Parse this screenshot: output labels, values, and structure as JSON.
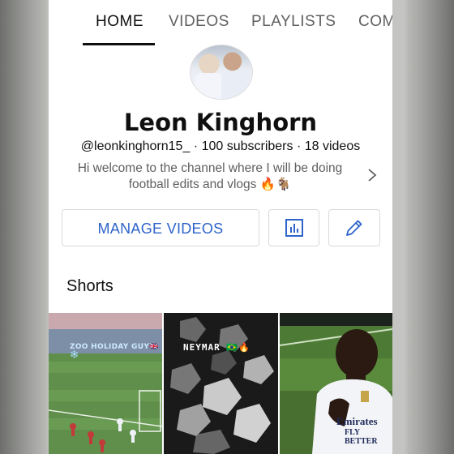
{
  "tabs": [
    {
      "label": "HOME",
      "active": true
    },
    {
      "label": "VIDEOS",
      "active": false
    },
    {
      "label": "PLAYLISTS",
      "active": false
    },
    {
      "label": "COM",
      "active": false
    }
  ],
  "channel": {
    "name": "Leon Kinghorn",
    "meta": "@leonkinghorn15_ · 100 subscribers · 18 videos",
    "description_line1": "Hi welcome to the channel where I will be doing",
    "description_line2": "football edits and vlogs 🔥🐐"
  },
  "buttons": {
    "manage_videos": "MANAGE VIDEOS",
    "analytics_icon": "bar-chart-icon",
    "edit_icon": "pencil-icon"
  },
  "shorts": {
    "title": "Shorts",
    "items": [
      {
        "caption": "ZOO HOLIDAY GUY🇬🇧❄️"
      },
      {
        "caption": "NEYMAR 🇧🇷🔥"
      },
      {
        "jersey_text_1": "Emirates",
        "jersey_text_2": "FLY BETTER"
      }
    ]
  },
  "colors": {
    "accent_blue": "#2e63c9",
    "text_primary": "#0f0f0f",
    "text_secondary": "#606060"
  }
}
